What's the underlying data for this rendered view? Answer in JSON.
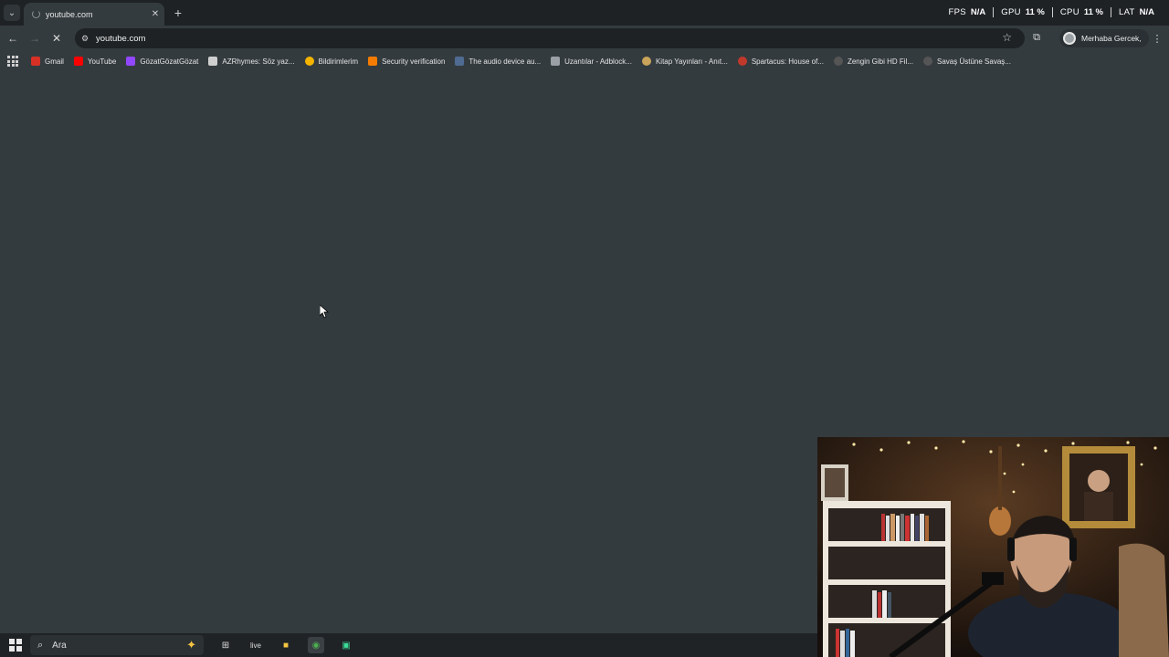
{
  "tab": {
    "title": "youtube.com",
    "close": "✕"
  },
  "new_tab": "+",
  "stats": [
    {
      "key": "FPS",
      "value": "N/A"
    },
    {
      "key": "GPU",
      "value": "11 %"
    },
    {
      "key": "CPU",
      "value": "11 %"
    },
    {
      "key": "LAT",
      "value": "N/A"
    }
  ],
  "toolbar": {
    "url": "youtube.com",
    "profile_name": "Merhaba Gercek,"
  },
  "bookmarks": [
    {
      "label": "Gmail",
      "color": "#d93025"
    },
    {
      "label": "YouTube",
      "color": "#ff0000"
    },
    {
      "label": "GözatGözatGözat",
      "color": "#9147ff"
    },
    {
      "label": "AZRhymes: Söz yaz...",
      "color": "#cfcfcf"
    },
    {
      "label": "Bildirimlerim",
      "color": "#f4b400"
    },
    {
      "label": "Security verification",
      "color": "#f57c00"
    },
    {
      "label": "The audio device au...",
      "color": "#4f6b91"
    },
    {
      "label": "Uzantılar - Adblock...",
      "color": "#9aa0a6"
    },
    {
      "label": "Kitap Yayınları - Anıt...",
      "color": "#c9a45a"
    },
    {
      "label": "Spartacus: House of...",
      "color": "#c0392b"
    },
    {
      "label": "Zengin Gibi HD Fil...",
      "color": "#444"
    },
    {
      "label": "Savaş Üstüne Savaş...",
      "color": "#444"
    }
  ],
  "taskbar": {
    "search_placeholder": "Ara",
    "apps": [
      {
        "name": "task-view",
        "glyph": "⊞"
      },
      {
        "name": "live",
        "glyph": "live"
      },
      {
        "name": "file-explorer",
        "glyph": "■"
      },
      {
        "name": "chrome",
        "glyph": "◉"
      },
      {
        "name": "media-app",
        "glyph": "▣"
      }
    ]
  }
}
